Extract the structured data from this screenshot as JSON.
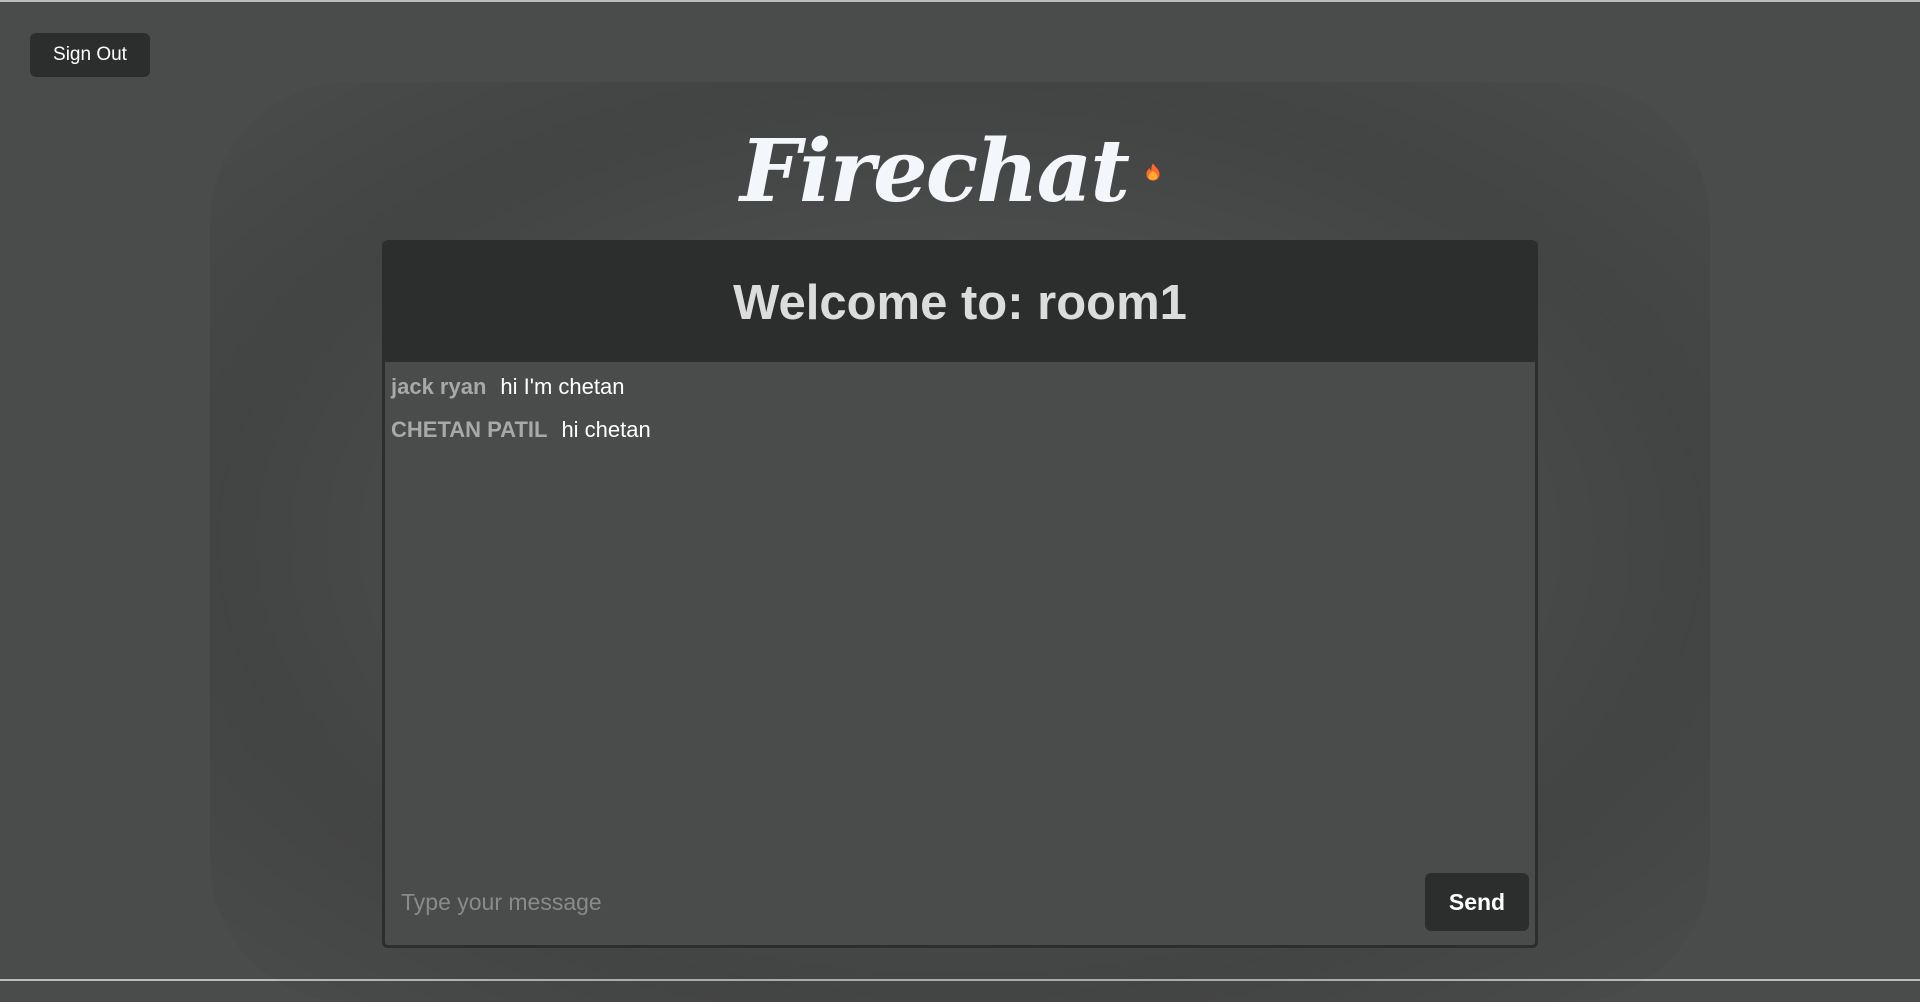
{
  "auth": {
    "sign_out_label": "Sign Out"
  },
  "logo": {
    "text": "Firechat",
    "icon": "flame-icon",
    "flame_outer_color": "#ff6a2a",
    "flame_inner_color": "#ffac33"
  },
  "chat": {
    "title": "Welcome to: room1",
    "messages": [
      {
        "user": "jack ryan",
        "text": "hi I'm chetan"
      },
      {
        "user": "CHETAN PATIL",
        "text": "hi chetan"
      }
    ],
    "input": {
      "value": "",
      "placeholder": "Type your message"
    },
    "send_label": "Send"
  },
  "colors": {
    "background": "#4a4b4b",
    "panel_dark": "#2c2e2e",
    "username": "#a8a8a8",
    "message_text": "#ffffff"
  }
}
